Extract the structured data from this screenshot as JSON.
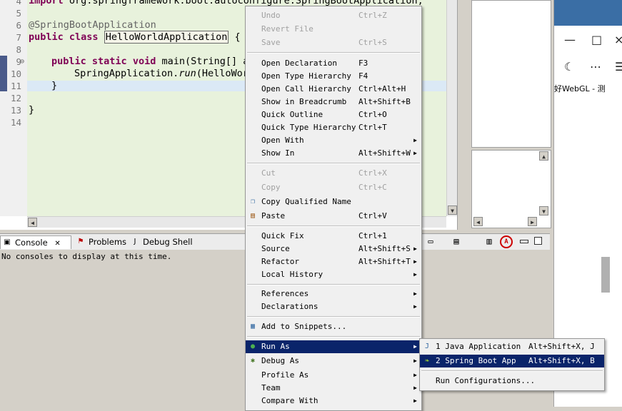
{
  "editor": {
    "lines": [
      {
        "num": "4",
        "text": "import org.springframework.boot.autoconfigure.SpringBootApplication;"
      },
      {
        "num": "5",
        "text": ""
      },
      {
        "num": "6",
        "text": "@SpringBootApplication"
      },
      {
        "num": "7",
        "text": "public class HelloWorldApplication {"
      },
      {
        "num": "8",
        "text": ""
      },
      {
        "num": "9",
        "text": "public static void main(String[] a"
      },
      {
        "num": "10",
        "text": "SpringApplication.run(HelloWor"
      },
      {
        "num": "11",
        "text": "}"
      },
      {
        "num": "12",
        "text": ""
      },
      {
        "num": "13",
        "text": "}"
      },
      {
        "num": "14",
        "text": ""
      }
    ],
    "code": {
      "import_kw": "import",
      "import_rest": " org.springframework.boot.autoconfigure.SpringBootApplication;",
      "annotation": "@SpringBootApplication",
      "public_kw": "public",
      "class_kw": "class",
      "class_name": "HelloWorldApplication",
      "brace_open": " {",
      "static_kw": "static",
      "void_kw": "void",
      "main_sig": " main(String[] a",
      "spring_app": "SpringApplication.",
      "run_method": "run",
      "run_args": "(HelloWor",
      "brace_close": "}",
      "fold_marker": "⊖"
    }
  },
  "browser": {
    "tab_text": "好WebGL - 测",
    "close_glyph": "×",
    "maximize_glyph": "□",
    "minimize_glyph": "—",
    "moon_glyph": "☾",
    "more_glyph": "⋯",
    "menu_glyph": "☰"
  },
  "console_panel": {
    "tabs": [
      {
        "label": "Console",
        "close": "✕"
      },
      {
        "label": "Problems"
      },
      {
        "label": "Debug Shell"
      }
    ],
    "message": "No consoles to display at this time."
  },
  "context_menu": {
    "items": [
      {
        "label": "Undo",
        "accel": "Ctrl+Z",
        "disabled": true
      },
      {
        "label": "Revert File",
        "accel": "",
        "disabled": true
      },
      {
        "label": "Save",
        "accel": "Ctrl+S",
        "disabled": true
      },
      {
        "label": "Open Declaration",
        "accel": "F3"
      },
      {
        "label": "Open Type Hierarchy",
        "accel": "F4"
      },
      {
        "label": "Open Call Hierarchy",
        "accel": "Ctrl+Alt+H"
      },
      {
        "label": "Show in Breadcrumb",
        "accel": "Alt+Shift+B"
      },
      {
        "label": "Quick Outline",
        "accel": "Ctrl+O"
      },
      {
        "label": "Quick Type Hierarchy",
        "accel": "Ctrl+T"
      },
      {
        "label": "Open With",
        "accel": ""
      },
      {
        "label": "Show In",
        "accel": "Alt+Shift+W"
      },
      {
        "label": "Cut",
        "accel": "Ctrl+X",
        "disabled": true
      },
      {
        "label": "Copy",
        "accel": "Ctrl+C",
        "disabled": true
      },
      {
        "label": "Copy Qualified Name",
        "accel": ""
      },
      {
        "label": "Paste",
        "accel": "Ctrl+V"
      },
      {
        "label": "Quick Fix",
        "accel": "Ctrl+1"
      },
      {
        "label": "Source",
        "accel": "Alt+Shift+S"
      },
      {
        "label": "Refactor",
        "accel": "Alt+Shift+T"
      },
      {
        "label": "Local History",
        "accel": ""
      },
      {
        "label": "References",
        "accel": ""
      },
      {
        "label": "Declarations",
        "accel": ""
      },
      {
        "label": "Add to Snippets...",
        "accel": ""
      },
      {
        "label": "Run As",
        "accel": ""
      },
      {
        "label": "Debug As",
        "accel": ""
      },
      {
        "label": "Profile As",
        "accel": ""
      },
      {
        "label": "Team",
        "accel": ""
      },
      {
        "label": "Compare With",
        "accel": ""
      }
    ],
    "submenu_arrow": "▶"
  },
  "run_as_submenu": {
    "items": [
      {
        "label": "1 Java Application",
        "accel": "Alt+Shift+X, J"
      },
      {
        "label": "2 Spring Boot App",
        "accel": "Alt+Shift+X, B"
      },
      {
        "label": "Run Configurations...",
        "accel": ""
      }
    ]
  },
  "scroll": {
    "up": "▲",
    "down": "▼",
    "left": "◀",
    "right": "▶"
  }
}
